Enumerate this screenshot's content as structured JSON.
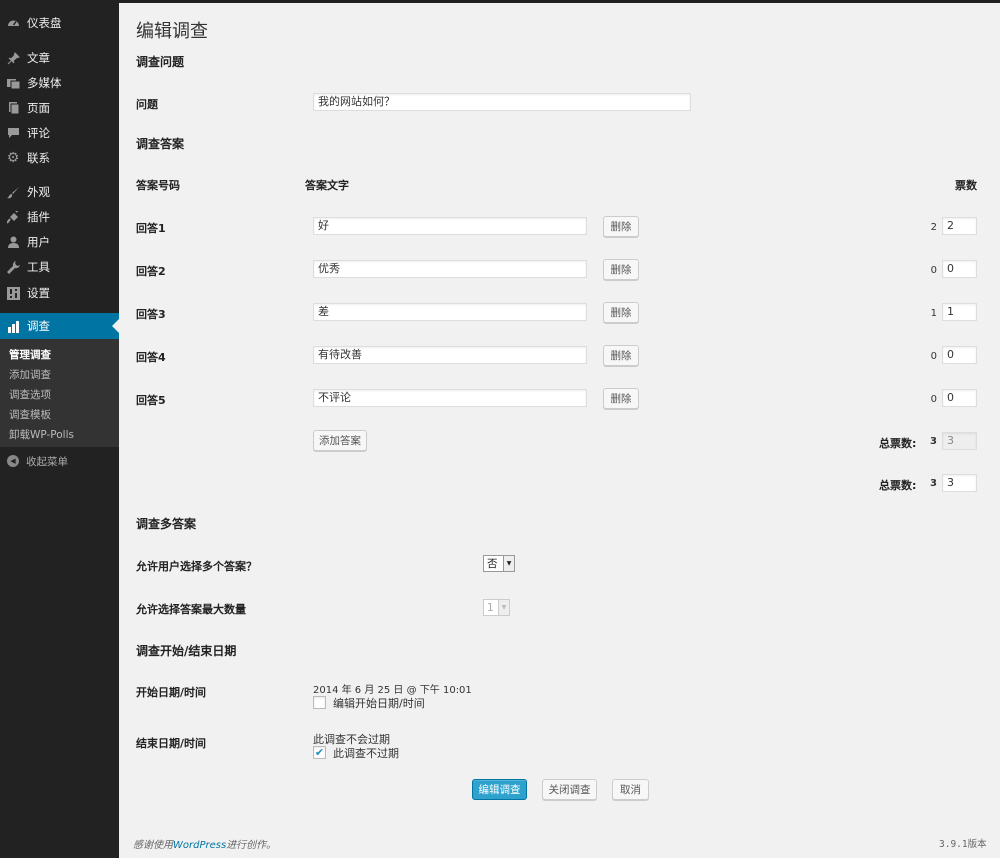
{
  "sidebar": {
    "items": [
      {
        "label": "仪表盘",
        "icon": "dashboard-icon"
      },
      {
        "label": "文章",
        "icon": "pin-icon"
      },
      {
        "label": "多媒体",
        "icon": "media-icon"
      },
      {
        "label": "页面",
        "icon": "pages-icon"
      },
      {
        "label": "评论",
        "icon": "comment-icon"
      },
      {
        "label": "联系",
        "icon": "gear-icon"
      },
      {
        "label": "外观",
        "icon": "brush-icon"
      },
      {
        "label": "插件",
        "icon": "plugin-icon"
      },
      {
        "label": "用户",
        "icon": "user-icon"
      },
      {
        "label": "工具",
        "icon": "wrench-icon"
      },
      {
        "label": "设置",
        "icon": "settings-icon"
      },
      {
        "label": "调查",
        "icon": "chart-icon"
      }
    ],
    "submenu": [
      "管理调查",
      "添加调查",
      "调查选项",
      "调查模板",
      "卸载WP-Polls"
    ],
    "collapse_label": "收起菜单"
  },
  "page_title": "编辑调查",
  "question_section": {
    "heading": "调查问题",
    "label": "问题",
    "value": "我的网站如何？"
  },
  "answers_section": {
    "heading": "调查答案",
    "col_number": "答案号码",
    "col_text": "答案文字",
    "col_votes": "票数",
    "delete_label": "删除",
    "answers": [
      {
        "label": "回答1",
        "text": "好",
        "votes_static": "2",
        "votes": "2"
      },
      {
        "label": "回答2",
        "text": "优秀",
        "votes_static": "0",
        "votes": "0"
      },
      {
        "label": "回答3",
        "text": "差",
        "votes_static": "1",
        "votes": "1"
      },
      {
        "label": "回答4",
        "text": "有待改善",
        "votes_static": "0",
        "votes": "0"
      },
      {
        "label": "回答5",
        "text": "不评论",
        "votes_static": "0",
        "votes": "0"
      }
    ],
    "add_answer_label": "添加答案",
    "total_votes_label": "总票数:",
    "total_votes_static": "3",
    "total_votes_value": "3",
    "total_voters_label": "总票数:",
    "total_voters_static": "3",
    "total_voters_value": "3"
  },
  "multi_section": {
    "heading": "调查多答案",
    "allow_label": "允许用户选择多个答案？",
    "allow_value": "否",
    "max_label": "允许选择答案最大数量",
    "max_value": "1"
  },
  "date_section": {
    "heading": "调查开始/结束日期",
    "start_label": "开始日期/时间",
    "start_value": "2014 年 6 月 25 日 @ 下午 10:01",
    "edit_start_label": "编辑开始日期/时间",
    "end_label": "结束日期/时间",
    "end_value": "此调查不会过期",
    "no_expiry_label": "此调查不过期",
    "no_expiry_checked": true
  },
  "actions": {
    "edit": "编辑调查",
    "close": "关闭调查",
    "cancel": "取消"
  },
  "footer": {
    "thanks_prefix": "感谢使用",
    "wordpress_link": "WordPress",
    "thanks_suffix": "进行创作。",
    "version": "3.9.1版本"
  },
  "colors": {
    "sidebar_bg": "#222222",
    "active_menu": "#0074a2",
    "primary_button": "#2ea2cc",
    "page_bg": "#f1f1f1"
  }
}
